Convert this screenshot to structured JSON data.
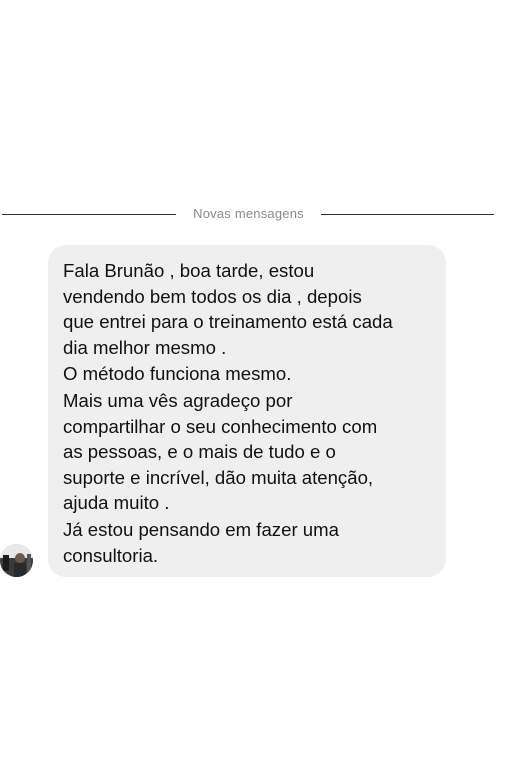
{
  "chat": {
    "divider_label": "Novas mensagens",
    "message": {
      "paragraphs": [
        {
          "lines": [
            "Fala Brunão , boa tarde, estou",
            "vendendo bem todos os dia , depois",
            "que entrei para o treinamento está cada",
            "dia melhor mesmo ."
          ]
        },
        {
          "lines": [
            "O método funciona mesmo."
          ]
        },
        {
          "lines": [
            "Mais uma vês agradeço por",
            "compartilhar o seu conhecimento com",
            "as pessoas, e o mais de tudo e o",
            "suporte e incrível, dão muita atenção,",
            "ajuda muito ."
          ]
        },
        {
          "lines": [
            "Já estou pensando em fazer uma",
            "consultoria."
          ]
        }
      ]
    }
  }
}
